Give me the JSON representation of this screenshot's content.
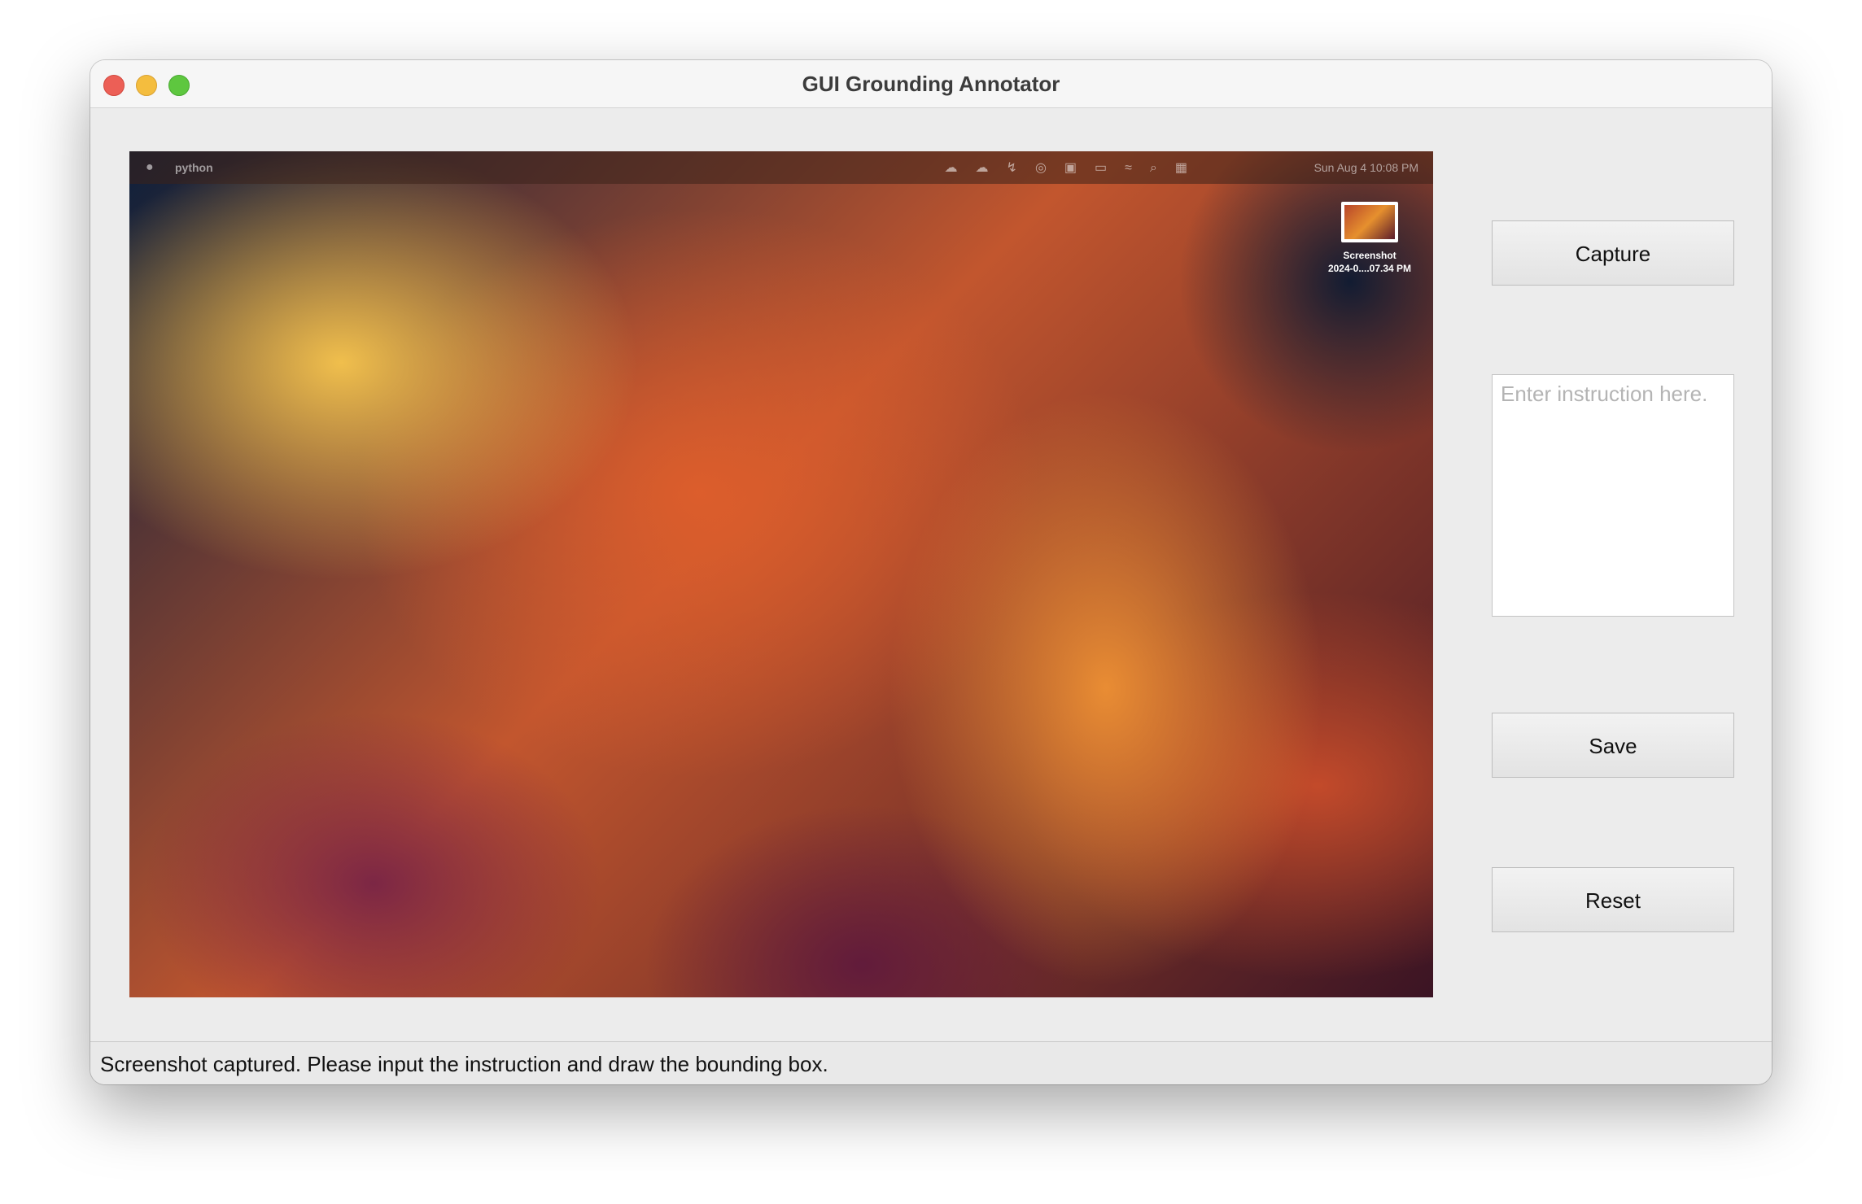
{
  "window": {
    "title": "GUI Grounding Annotator"
  },
  "screenshot": {
    "menubar": {
      "app_name": "python",
      "clock": "Sun Aug 4  10:08 PM"
    },
    "desktop_icon": {
      "label_line1": "Screenshot",
      "label_line2": "2024-0....07.34 PM"
    }
  },
  "controls": {
    "capture_label": "Capture",
    "instruction_placeholder": "Enter instruction here.",
    "save_label": "Save",
    "reset_label": "Reset"
  },
  "status": {
    "message": "Screenshot captured. Please input the instruction and draw the bounding box."
  }
}
